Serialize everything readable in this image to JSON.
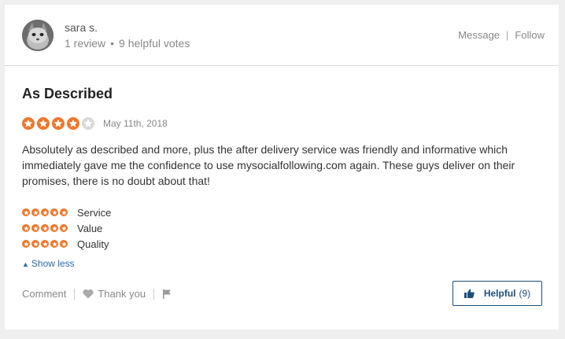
{
  "reviewer": {
    "name": "sara s.",
    "reviews": "1 review",
    "helpful_votes": "9 helpful votes"
  },
  "actions": {
    "message": "Message",
    "follow": "Follow"
  },
  "review": {
    "title": "As Described",
    "rating": 4,
    "max_rating": 5,
    "date": "May 11th, 2018",
    "text": "Absolutely as described and more, plus the after delivery service was friendly and informative which immediately gave me the confidence to use mysocialfollowing.com again. These guys deliver on their promises, there is no doubt about that!"
  },
  "sub_ratings": [
    {
      "label": "Service",
      "rating": 5
    },
    {
      "label": "Value",
      "rating": 5
    },
    {
      "label": "Quality",
      "rating": 5
    }
  ],
  "show_less": "Show less",
  "footer": {
    "comment": "Comment",
    "thank_you": "Thank you"
  },
  "helpful": {
    "label": "Helpful",
    "count": "(9)"
  },
  "colors": {
    "star_on": "#f0762a",
    "star_off": "#d9d9d9",
    "link": "#2c6aa8",
    "button": "#1f4e79"
  }
}
